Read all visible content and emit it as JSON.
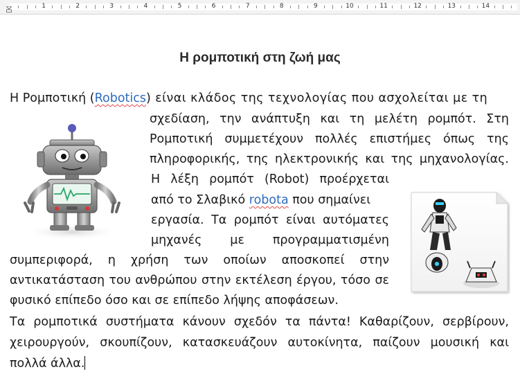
{
  "ruler": {
    "numbers": [
      "1",
      "2",
      "3",
      "4",
      "5",
      "6",
      "7",
      "8",
      "9",
      "10",
      "11",
      "12",
      "13",
      "14"
    ]
  },
  "document": {
    "title": "Η ρομποτική στη ζωή μας",
    "para1": {
      "line1_start": "Η Ρομποτική (",
      "line1_link": "Robotics",
      "line1_end": ") είναι κλάδος της τεχνολογίας που ασχολείται με τη",
      "line2": "σχεδίαση, την ανάπτυξη και τη μελέτη ρομπότ. Στη",
      "line3": "Ρομποτική συμμετέχουν πολλές επιστήμες όπως της",
      "line4": "πληροφορικής, της ηλεκτρονικής και της μηχανολογίας.",
      "line5": "Η λέξη ρομπότ (Robot) προέρχεται",
      "line6_start": "από το Σλαβικό ",
      "line6_link": "robota",
      "line6_end": " που σημαίνει",
      "line7": "εργασία. Τα ρομπότ είναι αυτόματες",
      "line8": "μηχανές με προγραμματισμένη",
      "line9": "συμπεριφορά, η χρήση των οποίων αποσκοπεί στην",
      "line10": "αντικατάσταση του ανθρώπου στην εκτέλεση έργου, τόσο σε",
      "line11": "φυσικό επίπεδο όσο και σε επίπεδο λήψης αποφάσεων."
    },
    "para2": {
      "line1": "Τα ρομποτικά συστήματα κάνουν σχεδόν τα πάντα! Καθαρίζουν, σερβίρουν,",
      "line2": "χειρουργούν, σκουπίζουν, κατασκευάζουν αυτοκίνητα, παίζουν μουσική και",
      "line3": "πολλά άλλα."
    }
  },
  "colors": {
    "link": "#2e6bbf",
    "spellcheck": "#e04545",
    "text": "#1a1a1a"
  }
}
